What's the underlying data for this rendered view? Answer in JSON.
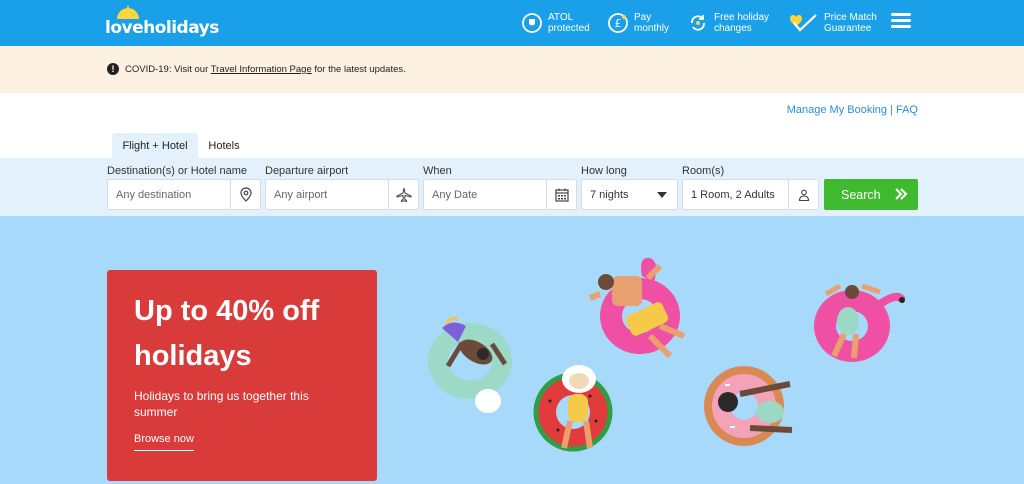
{
  "header": {
    "logo_text": "loveholidays",
    "usps": [
      {
        "line1": "ATOL",
        "line2": "protected",
        "icon": "atol-shield-icon"
      },
      {
        "line1": "Pay",
        "line2": "monthly",
        "icon": "pound-coin-icon"
      },
      {
        "line1": "Free holiday",
        "line2": "changes",
        "icon": "refresh-icon"
      },
      {
        "line1": "Price Match",
        "line2": "Guarantee",
        "icon": "heart-check-icon"
      }
    ],
    "menu_icon": "hamburger-menu-icon"
  },
  "banner": {
    "prefix": "COVID-19: Visit our ",
    "link": "Travel Information Page",
    "suffix": " for the latest updates."
  },
  "account_links": {
    "manage": "Manage My Booking",
    "separator": " | ",
    "faq": "FAQ"
  },
  "tabs": [
    {
      "label": "Flight + Hotel",
      "active": true
    },
    {
      "label": "Hotels",
      "active": false
    }
  ],
  "search": {
    "destination": {
      "label": "Destination(s) or Hotel name",
      "placeholder": "Any destination"
    },
    "departure": {
      "label": "Departure airport",
      "placeholder": "Any airport"
    },
    "when": {
      "label": "When",
      "placeholder": "Any Date"
    },
    "how_long": {
      "label": "How long",
      "value": "7 nights"
    },
    "rooms": {
      "label": "Room(s)",
      "value": "1 Room, 2 Adults"
    },
    "button": "Search"
  },
  "promo": {
    "title": "Up to 40% off holidays",
    "subtitle": "Holidays to bring us together this summer",
    "cta": "Browse now"
  },
  "colors": {
    "header_bg": "#1aa0e8",
    "banner_bg": "#fdf1e2",
    "search_bg": "#e3f1fc",
    "search_button": "#3fba2f",
    "hero_bg": "#a7d9fb",
    "promo_bg": "#d93a3a",
    "link": "#2a8fd6"
  }
}
